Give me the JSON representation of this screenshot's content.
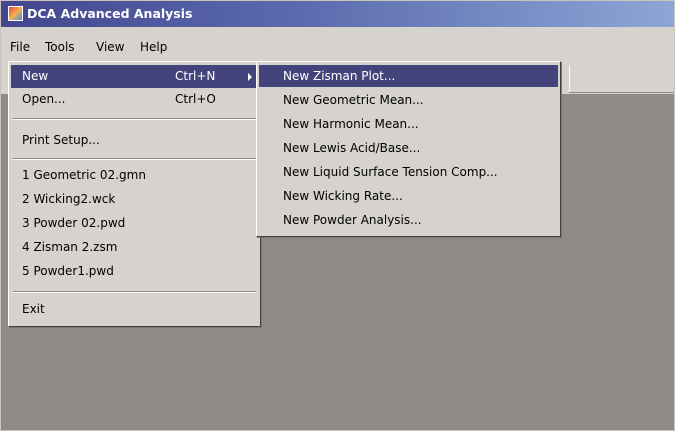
{
  "window": {
    "title": "DCA Advanced Analysis"
  },
  "menubar": {
    "items": [
      "File",
      "Tools",
      "View",
      "Help"
    ]
  },
  "file_menu": {
    "items": [
      {
        "label": "New",
        "shortcut": "Ctrl+N"
      },
      {
        "label": "Open...",
        "shortcut": "Ctrl+O"
      },
      {
        "label": "Print Setup..."
      },
      {
        "label": "1 Geometric 02.gmn"
      },
      {
        "label": "2 Wicking2.wck"
      },
      {
        "label": "3 Powder 02.pwd"
      },
      {
        "label": "4 Zisman 2.zsm"
      },
      {
        "label": "5 Powder1.pwd"
      },
      {
        "label": "Exit"
      }
    ]
  },
  "new_menu": {
    "items": [
      "New Zisman Plot...",
      "New Geometric Mean...",
      "New Harmonic Mean...",
      "New Lewis Acid/Base...",
      "New Liquid Surface Tension Comp...",
      "New Wicking Rate...",
      "New Powder Analysis..."
    ]
  },
  "colors": {
    "highlight": "#44447c",
    "workspace": "#8e8a86",
    "face": "#d6d3ce"
  },
  "icons": {
    "app": "app-icon",
    "submenu": "submenu-arrow-icon"
  }
}
